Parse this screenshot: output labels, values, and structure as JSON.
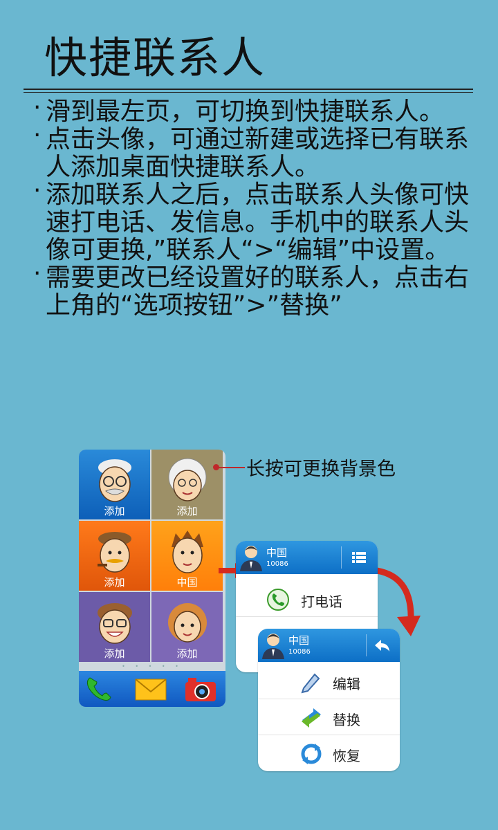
{
  "page": {
    "title": "快捷联系人",
    "tips": [
      "滑到最左页，可切换到快捷联系人。",
      "点击头像，可通过新建或选择已有联系人添加桌面快捷联系人。",
      "添加联系人之后，点击联系人头像可快速打电话、发信息。手机中的联系人头像可更换,”联系人“>“编辑”中设置。",
      "需要更改已经设置好的联系人，点击右上角的“选项按钮”>”替换”"
    ]
  },
  "phone": {
    "tiles": [
      {
        "label": "添加",
        "icon": "grandpa-avatar-icon"
      },
      {
        "label": "添加",
        "icon": "grandma-avatar-icon"
      },
      {
        "label": "添加",
        "icon": "pipe-man-avatar-icon"
      },
      {
        "label": "中国",
        "icon": "young-man-avatar-icon"
      },
      {
        "label": "添加",
        "icon": "glasses-man-avatar-icon"
      },
      {
        "label": "添加",
        "icon": "girl-avatar-icon"
      }
    ],
    "page_indicator": "• • • • •",
    "dock": [
      "phone-icon",
      "mail-icon",
      "camera-icon"
    ]
  },
  "callout": {
    "text": "长按可更换背景色"
  },
  "popup_main": {
    "contact_name": "中国",
    "contact_number": "10086",
    "menu_icon": "list-menu-icon",
    "actions": [
      {
        "label": "打电话",
        "icon": "call-icon"
      }
    ]
  },
  "popup_options": {
    "contact_name": "中国",
    "contact_number": "10086",
    "back_icon": "back-arrow-icon",
    "actions": [
      {
        "label": "编辑",
        "icon": "edit-pen-icon"
      },
      {
        "label": "替换",
        "icon": "replace-arrows-icon"
      },
      {
        "label": "恢复",
        "icon": "restore-icon"
      }
    ]
  },
  "colors": {
    "background": "#6ab7d0",
    "header_blue": "#1a7fd0",
    "arrow_red": "#d42a1e"
  }
}
